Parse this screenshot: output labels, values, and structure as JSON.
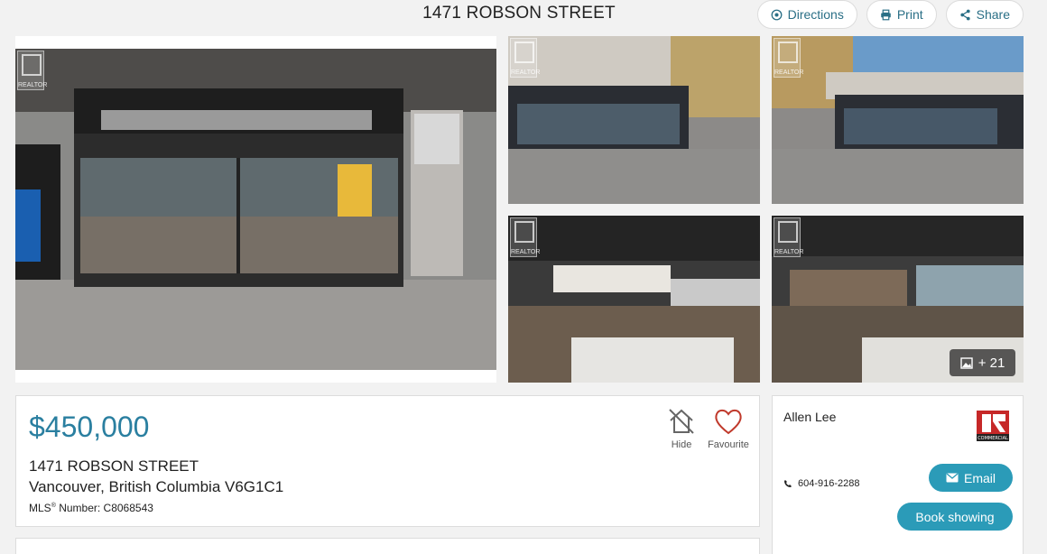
{
  "header": {
    "title": "1471 ROBSON STREET",
    "directions_label": "Directions",
    "print_label": "Print",
    "share_label": "Share"
  },
  "gallery": {
    "watermark_text": "REALTOR",
    "more_photos": "+ 21"
  },
  "listing": {
    "price": "$450,000",
    "address_line1": "1471 ROBSON STREET",
    "address_line2": "Vancouver, British Columbia V6G1C1",
    "mls_prefix": "MLS",
    "mls_sup": "®",
    "mls_suffix": " Number: C8068543",
    "hide_label": "Hide",
    "favourite_label": "Favourite"
  },
  "agent": {
    "name": "Allen Lee",
    "phone": "604-916-2288",
    "email_label": "Email",
    "book_label": "Book showing",
    "logo_text": "COMMERCIAL"
  },
  "colors": {
    "accent": "#2a7fa0",
    "button": "#2b9bb8",
    "favourite": "#c0392b"
  }
}
